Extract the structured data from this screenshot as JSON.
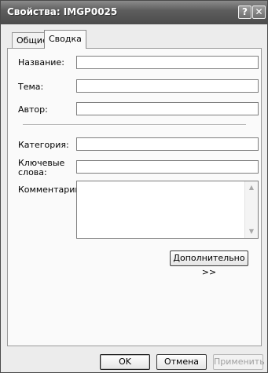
{
  "window": {
    "title": "Свойства: IMGP0025",
    "help_glyph": "?",
    "close_glyph": "✕"
  },
  "tabs": [
    {
      "label": "Общие",
      "active": false
    },
    {
      "label": "Сводка",
      "active": true
    }
  ],
  "form": {
    "title_label": "Название:",
    "title_value": "",
    "subject_label": "Тема:",
    "subject_value": "",
    "author_label": "Автор:",
    "author_value": "",
    "category_label": "Категория:",
    "category_value": "",
    "keywords_label": "Ключевые слова:",
    "keywords_value": "",
    "comments_label": "Комментарий:",
    "comments_value": "",
    "advanced_button": "Дополнительно >>"
  },
  "buttons": {
    "ok": "OK",
    "cancel": "Отмена",
    "apply": "Применить"
  }
}
